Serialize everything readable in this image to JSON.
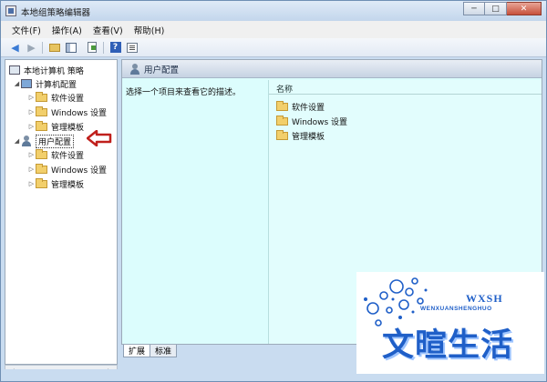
{
  "window": {
    "title": "本地组策略编辑器",
    "controls": {
      "minimize": "─",
      "maximize": "□",
      "close": "✕"
    }
  },
  "menu": [
    "文件(F)",
    "操作(A)",
    "查看(V)",
    "帮助(H)"
  ],
  "toolbar": {
    "back_icon": "◆",
    "forward_icon": "◆",
    "help_glyph": "?"
  },
  "tree": {
    "root": "本地计算机 策略",
    "computer_config": "计算机配置",
    "user_config": "用户配置",
    "children": [
      "软件设置",
      "Windows 设置",
      "管理模板"
    ],
    "expand_glyph": "◢",
    "collapse_glyph": "▷"
  },
  "right_pane": {
    "header": "用户配置",
    "description": "选择一个项目来查看它的描述。",
    "column_name": "名称",
    "items": [
      "软件设置",
      "Windows 设置",
      "管理模板"
    ]
  },
  "tabs": [
    "扩展",
    "标准"
  ],
  "watermark": {
    "small": "WXSH",
    "roman": "WENXUANSHENGHUO",
    "big": "文暄生活"
  },
  "colors": {
    "selection_arrow": "#c0201c",
    "pane_bg": "#dcfdfd",
    "watermark": "#1f5fc8"
  }
}
